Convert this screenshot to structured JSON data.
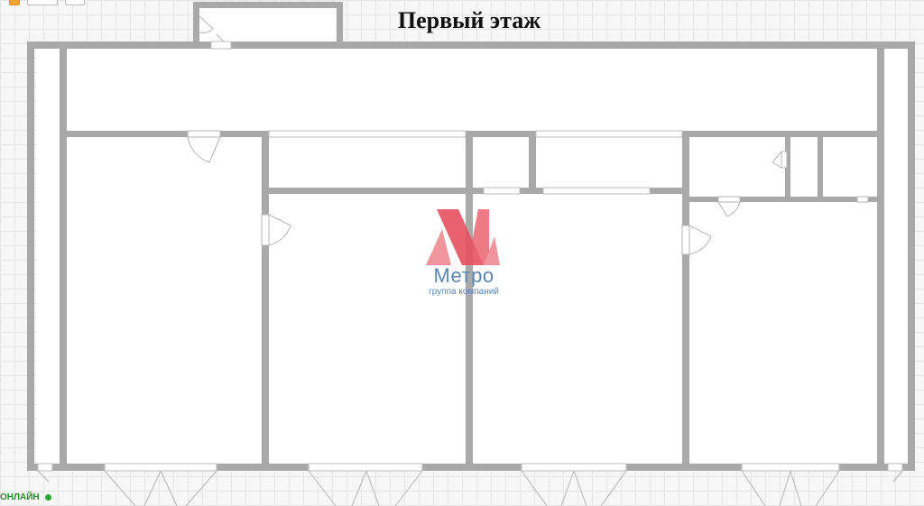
{
  "title": "Первый этаж",
  "status": {
    "label": "ОНЛАЙН",
    "color": "#22aa33"
  },
  "logo": {
    "word": "Метро",
    "subtitle": "группа компаний",
    "mark_color": "#e8515f",
    "text_color": "#5b86b4"
  },
  "top_badges": [
    "",
    "",
    ""
  ],
  "colors": {
    "wall": "#a9a9a9",
    "room_fill": "#ffffff",
    "background": "#f7f7f7"
  }
}
